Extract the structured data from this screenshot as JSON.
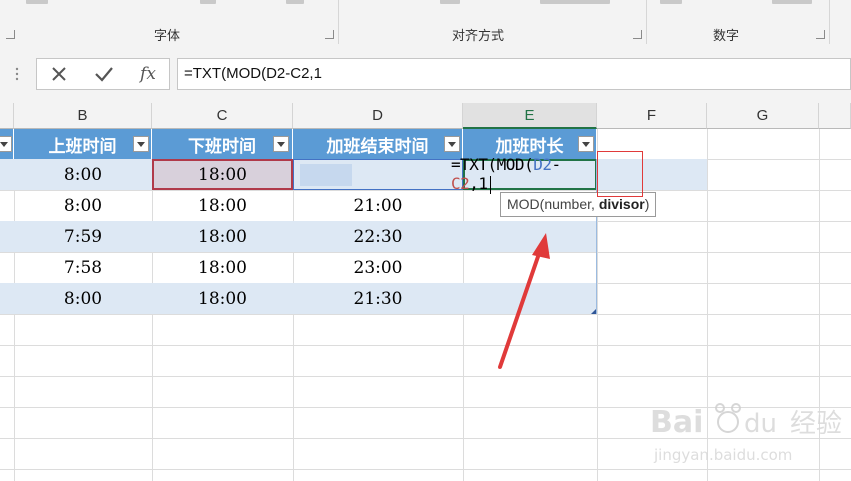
{
  "ribbon": {
    "groups": [
      {
        "label": "字体"
      },
      {
        "label": "对齐方式"
      },
      {
        "label": "数字"
      }
    ]
  },
  "formula_bar": {
    "cancel_glyph": "✕",
    "enter_glyph": "✓",
    "fx_label": "fx",
    "formula_text": "=TXT(MOD(D2-C2,1"
  },
  "columns": [
    "B",
    "C",
    "D",
    "E",
    "F",
    "G"
  ],
  "table": {
    "headers": [
      "上班时间",
      "下班时间",
      "加班结束时间",
      "加班时长"
    ],
    "rows": [
      [
        "8:00",
        "18:00",
        "",
        ""
      ],
      [
        "8:00",
        "18:00",
        "21:00",
        ""
      ],
      [
        "7:59",
        "18:00",
        "22:30",
        ""
      ],
      [
        "7:58",
        "18:00",
        "23:00",
        ""
      ],
      [
        "8:00",
        "18:00",
        "21:30",
        ""
      ]
    ]
  },
  "edit_cell": {
    "prefix": "=TXT(MOD(",
    "ref1": "D2",
    "minus": "-",
    "ref2": "C2",
    "suffix": ",1"
  },
  "tooltip": {
    "func": "MOD(number, ",
    "arg_bold": "divisor",
    "close": ")"
  },
  "colors": {
    "header_blue": "#5b9bd5",
    "band_blue": "#dde8f4",
    "ref_blue": "#4472c4",
    "ref_red": "#c0504d",
    "annotation_red": "#e03a3a"
  }
}
